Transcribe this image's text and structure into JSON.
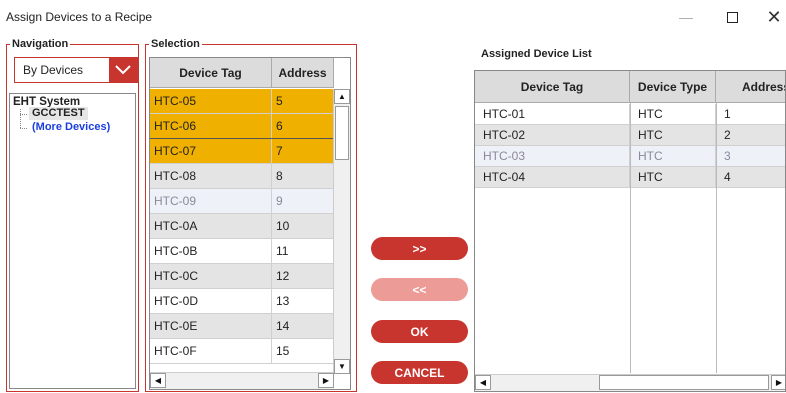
{
  "window": {
    "title": "Assign Devices to a Recipe",
    "minimize": "—",
    "close": "✕"
  },
  "navigation": {
    "label": "Navigation",
    "dropdown_value": "By Devices",
    "tree": {
      "root": "EHT System",
      "children": [
        "GCCTEST",
        "(More Devices)"
      ]
    }
  },
  "selection": {
    "label": "Selection",
    "columns": [
      "Device Tag",
      "Address"
    ],
    "rows": [
      {
        "tag": "HTC-05",
        "address": "5",
        "state": "selected"
      },
      {
        "tag": "HTC-06",
        "address": "6",
        "state": "selected"
      },
      {
        "tag": "HTC-07",
        "address": "7",
        "state": "selected-focus"
      },
      {
        "tag": "HTC-08",
        "address": "8",
        "state": "alt"
      },
      {
        "tag": "HTC-09",
        "address": "9",
        "state": "hover"
      },
      {
        "tag": "HTC-0A",
        "address": "10",
        "state": "alt"
      },
      {
        "tag": "HTC-0B",
        "address": "11",
        "state": "normal"
      },
      {
        "tag": "HTC-0C",
        "address": "12",
        "state": "alt"
      },
      {
        "tag": "HTC-0D",
        "address": "13",
        "state": "normal"
      },
      {
        "tag": "HTC-0E",
        "address": "14",
        "state": "alt"
      },
      {
        "tag": "HTC-0F",
        "address": "15",
        "state": "normal"
      }
    ]
  },
  "buttons": {
    "add": ">>",
    "remove": "<<",
    "ok": "OK",
    "cancel": "CANCEL"
  },
  "assigned": {
    "label": "Assigned Device List",
    "columns": [
      "Device Tag",
      "Device Type",
      "Address"
    ],
    "rows": [
      {
        "tag": "HTC-01",
        "type": "HTC",
        "address": "1",
        "state": "normal"
      },
      {
        "tag": "HTC-02",
        "type": "HTC",
        "address": "2",
        "state": "alt"
      },
      {
        "tag": "HTC-03",
        "type": "HTC",
        "address": "3",
        "state": "hover"
      },
      {
        "tag": "HTC-04",
        "type": "HTC",
        "address": "4",
        "state": "alt"
      }
    ]
  },
  "colors": {
    "accent": "#c8342e",
    "selected_row": "#f0b000",
    "alt_row": "#e4e4e4",
    "hover_row": "#eef1f8",
    "hover_text": "#8a8a9a",
    "tree_link": "#1a3fe0"
  }
}
